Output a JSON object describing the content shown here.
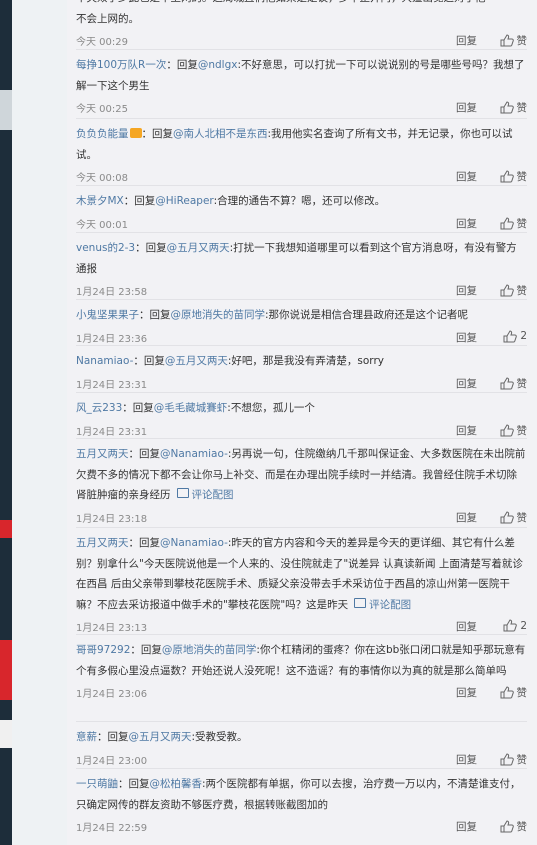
{
  "reply_label": "回复",
  "like_label": "赞",
  "pic_label": "评论配图",
  "top_partial": {
    "text": "不会上网的。",
    "clipped_line": "不失效了少此也是千上网的。这局城且们他如果是定议，多平正开内，大造出觉这对于他",
    "time": "今天 00:29",
    "like": "赞"
  },
  "comments": [
    {
      "user": "每挣100万队R一次",
      "mention": "@ndlgx",
      "text": ":不好意思，可以打扰一下可以说说别的号是哪些号吗？我想了解一下这个男生",
      "time": "今天 00:25",
      "like": "赞"
    },
    {
      "user": "负负负能量",
      "mention": "@南人北相不是东西",
      "text": ":我用他实名查询了所有文书，并无记录，你也可以试试。",
      "time": "今天 00:08",
      "like": "赞"
    },
    {
      "user": "木景夕MX",
      "mention": "@HiReaper",
      "text": ":合理的通告不算？嗯，还可以修改。",
      "time": "今天 00:01",
      "like": "赞"
    },
    {
      "user": "venus的2-3",
      "mention": "@五月又两天",
      "text": ":打扰一下我想知道哪里可以看到这个官方消息呀，有没有警方通报",
      "time": "1月24日 23:58",
      "like": "赞"
    },
    {
      "user": "小鬼坚果果子",
      "mention": "@原地消失的苗同学",
      "text": ":那你说说是相信合理县政府还是这个记者呢",
      "time": "1月24日 23:36",
      "like": "2"
    },
    {
      "user": "Nanamiao-",
      "mention": "@五月又两天",
      "text": ":好吧，那是我没有弄清楚，sorry",
      "time": "1月24日 23:31",
      "like": "赞"
    },
    {
      "user": "风_云233",
      "mention": "@毛毛藏城賽虾",
      "text": ":不想您，孤儿一个",
      "time": "1月24日 23:31",
      "like": "赞"
    },
    {
      "user": "五月又两天",
      "mention": "@Nanamiao-",
      "text": ":另再说一句，住院缴纳几千那叫保证金、大多数医院在未出院前欠费不多的情况下都不会让你马上补交、而是在办理出院手续时一并结清。我曾经住院手术切除肾脏肿瘤的亲身经历",
      "time": "1月24日 23:18",
      "like": "赞",
      "has_pic": true
    },
    {
      "user": "五月又两天",
      "mention": "@Nanamiao-",
      "text": ":昨天的官方内容和今天的差异是今天的更详细、其它有什么差别？别拿什么\"今天医院说他是一个人来的、没住院就走了\"说差异 认真读新闻 上面清楚写着就诊在西昌 后由父亲带到攀枝花医院手术、质疑父亲没带去手术采访位于西昌的凉山州第一医院干嘛？不应去采访报道中做手术的\"攀枝花医院\"吗？这是昨天",
      "time": "1月24日 23:13",
      "like": "2",
      "has_pic": true
    },
    {
      "user": "哥哥97292",
      "mention": "@原地消失的苗同学",
      "text": ":你个杠精闭的蛋疼？你在这bb张口闭口就是知乎那玩意有个有多假心里没点逼数？开始还说人没死呢！这不造谣？有的事情你以为真的就是那么简单吗",
      "time": "1月24日 23:06",
      "like": "赞"
    },
    {
      "user": "意薪",
      "mention": "@五月又两天",
      "text": ":受教受教。",
      "time": "1月24日 23:00",
      "like": "赞"
    },
    {
      "user": "一只萌鼬",
      "mention": "@松柏馨香",
      "text": ":两个医院都有单据，你可以去搜，治疗费一万以内，不清楚谁支付，只确定网传的群友资助不够医疗费，根据转账截图加的",
      "time": "1月24日 22:59",
      "like": "赞"
    }
  ]
}
